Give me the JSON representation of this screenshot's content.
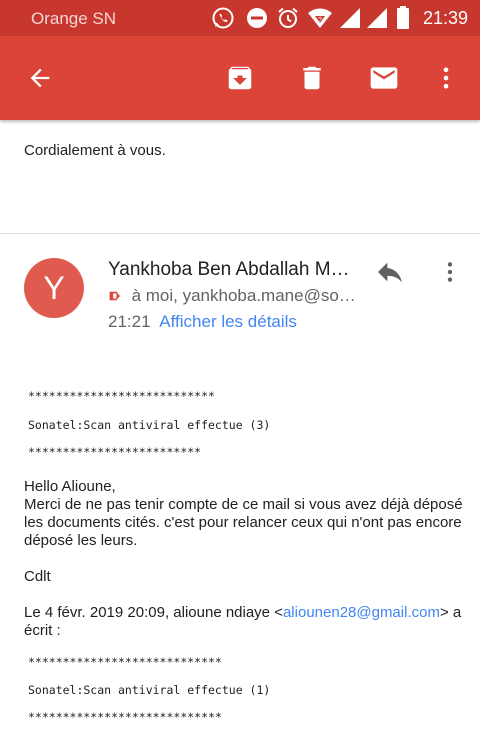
{
  "status_bar": {
    "carrier": "Orange SN",
    "time": "21:39",
    "icons": [
      "whatsapp-icon",
      "do-not-disturb-icon",
      "alarm-icon",
      "wifi-icon",
      "signal-icon",
      "signal-icon",
      "battery-icon"
    ]
  },
  "app_bar": {
    "icons": [
      "back-arrow-icon",
      "archive-icon",
      "delete-icon",
      "mail-icon",
      "more-vert-icon"
    ]
  },
  "previous_message": {
    "text": "Cordialement à vous."
  },
  "message": {
    "avatar_letter": "Y",
    "sender": "Yankhoba Ben Abdallah Mane",
    "recipients": "à moi, yankhoba.mane@sonatel.sn",
    "time": "21:21",
    "details_link": "Afficher les détails",
    "scan_stars_top": "***************************",
    "scan_line_1": "Sonatel:Scan antiviral effectue (3)",
    "scan_stars_bottom": "*************************",
    "greeting": "Hello Alioune,",
    "body_line1": "Merci de ne pas tenir compte de ce mail si vous avez déjà déposé",
    "body_line2": "les documents cités. c'est pour relancer ceux qui n'ont pas encore",
    "body_line3": "déposé les leurs.",
    "signoff": "Cdlt",
    "quote_prefix": "Le 4 févr. 2019 20:09, alioune ndiaye <",
    "quote_email": "aliounen28@gmail.com",
    "quote_suffix": "> a",
    "quote_suffix2": "écrit :",
    "quoted_stars_top": "****************************",
    "quoted_scan_line": "Sonatel:Scan antiviral effectue (1)",
    "quoted_stars_bottom": "****************************"
  },
  "colors": {
    "status_bar": "#c8372d",
    "app_bar": "#db4437",
    "avatar": "#e05b4f",
    "link": "#4285f4"
  }
}
